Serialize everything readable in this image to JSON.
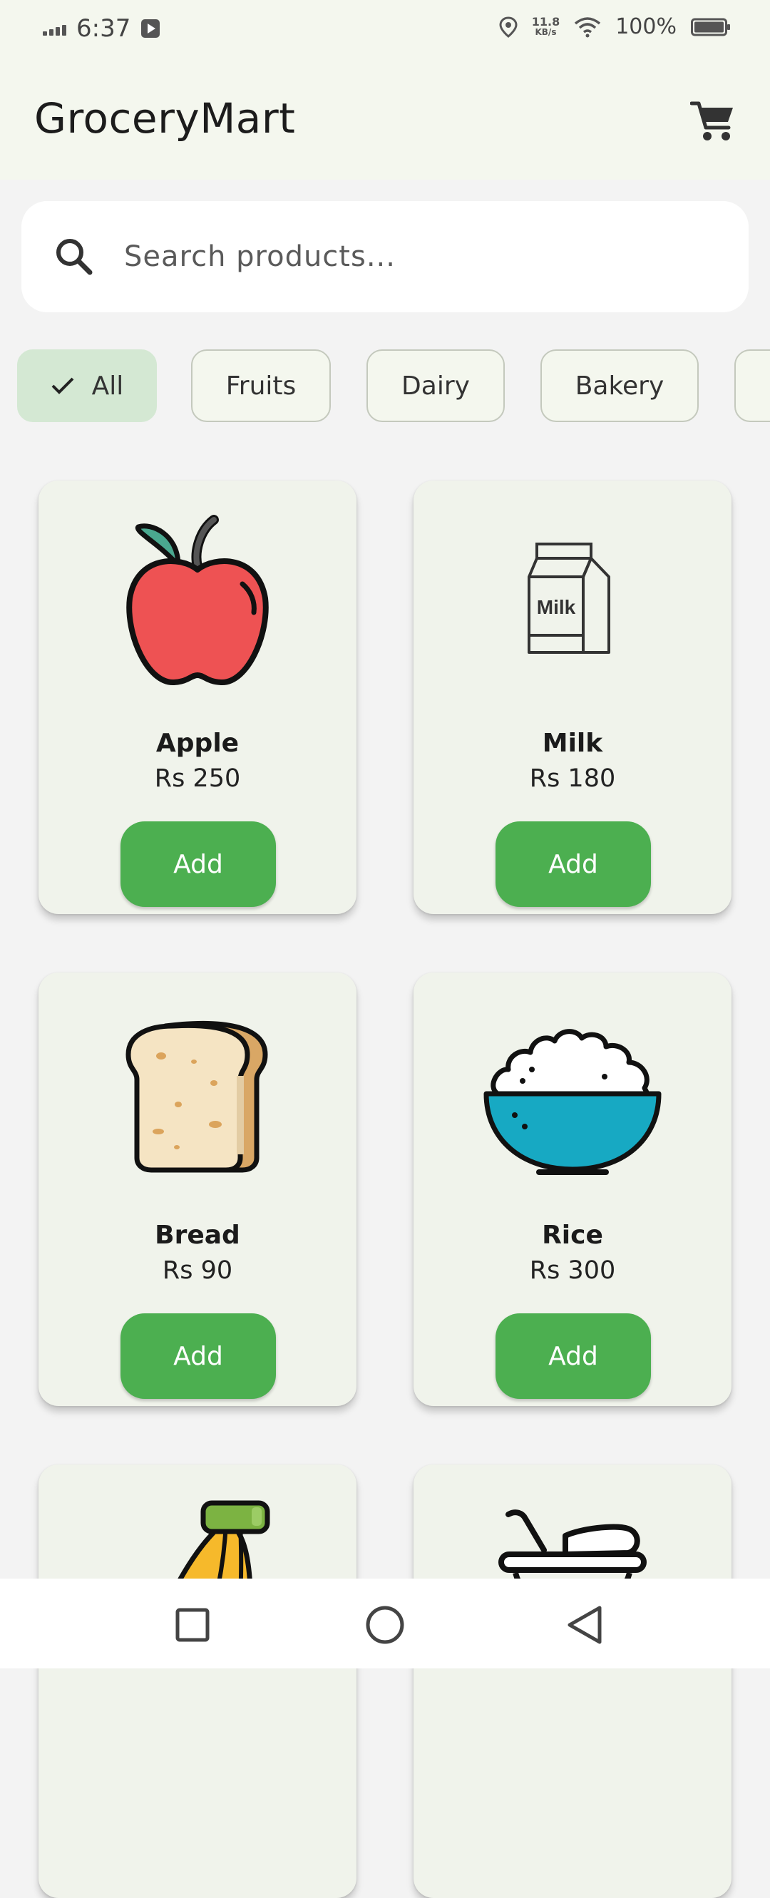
{
  "status_bar": {
    "time": "6:37",
    "speed_value": "11.8",
    "speed_unit": "KB/s",
    "battery": "100%"
  },
  "app_bar": {
    "title": "GroceryMart",
    "cart_icon": "shopping-cart-icon"
  },
  "search": {
    "placeholder": "Search products...",
    "icon": "search-icon"
  },
  "categories": [
    {
      "label": "All",
      "selected": true
    },
    {
      "label": "Fruits",
      "selected": false
    },
    {
      "label": "Dairy",
      "selected": false
    },
    {
      "label": "Bakery",
      "selected": false
    }
  ],
  "products": [
    {
      "name": "Apple",
      "price": "Rs 250",
      "button": "Add",
      "icon": "apple-icon"
    },
    {
      "name": "Milk",
      "price": "Rs 180",
      "button": "Add",
      "icon": "milk-carton-icon",
      "icon_text": "Milk"
    },
    {
      "name": "Bread",
      "price": "Rs 90",
      "button": "Add",
      "icon": "bread-icon"
    },
    {
      "name": "Rice",
      "price": "Rs 300",
      "button": "Add",
      "icon": "rice-bowl-icon"
    },
    {
      "icon": "banana-icon"
    },
    {
      "icon": "cereal-bowl-icon"
    }
  ],
  "colors": {
    "accent": "#4caf50",
    "app_bar_bg": "#f4f7ee",
    "chip_selected_bg": "#d4e8d3",
    "card_bg": "#f0f3eb"
  }
}
